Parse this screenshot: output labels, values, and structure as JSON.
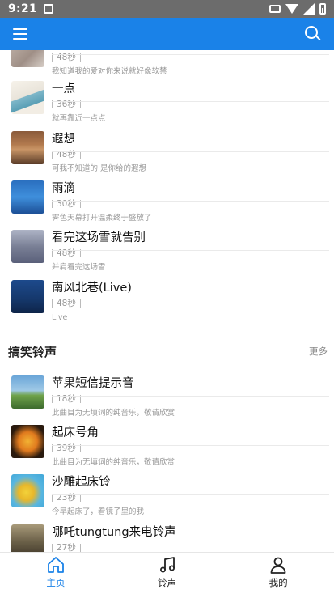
{
  "status_bar": {
    "time": "9:21"
  },
  "app_bar": {
    "menu_icon": "hamburger-menu-icon",
    "search_icon": "search-icon",
    "color": "#1a82e8"
  },
  "songs_top": [
    {
      "title": "",
      "duration": "48秒",
      "desc": "我知道我的爱对你来说就好像软禁"
    },
    {
      "title": "一点",
      "duration": "36秒",
      "desc": "就再靠近一点点"
    },
    {
      "title": "遐想",
      "duration": "48秒",
      "desc": "可我不知道的 是你给的遐想"
    },
    {
      "title": "雨滴",
      "duration": "30秒",
      "desc": "霁色天幕打开温柔终于盛放了"
    },
    {
      "title": "看完这场雪就告别",
      "duration": "48秒",
      "desc": "并肩看完这场雪"
    },
    {
      "title": "南风北巷(Live)",
      "duration": "48秒",
      "desc": "Live"
    }
  ],
  "section": {
    "title": "搞笑铃声",
    "more": "更多"
  },
  "songs_funny": [
    {
      "title": "苹果短信提示音",
      "duration": "18秒",
      "desc": "此曲目为无填词的纯音乐，敬请欣赏"
    },
    {
      "title": "起床号角",
      "duration": "39秒",
      "desc": "此曲目为无填词的纯音乐，敬请欣赏"
    },
    {
      "title": "沙雕起床铃",
      "duration": "23秒",
      "desc": "今早起床了，看镜子里的我"
    },
    {
      "title": "哪吒tungtung来电铃声",
      "duration": "27秒",
      "desc": ""
    }
  ],
  "bottom_nav": [
    {
      "label": "主页",
      "icon": "home-icon",
      "active": true
    },
    {
      "label": "铃声",
      "icon": "music-note-icon",
      "active": false
    },
    {
      "label": "我的",
      "icon": "person-icon",
      "active": false
    }
  ]
}
